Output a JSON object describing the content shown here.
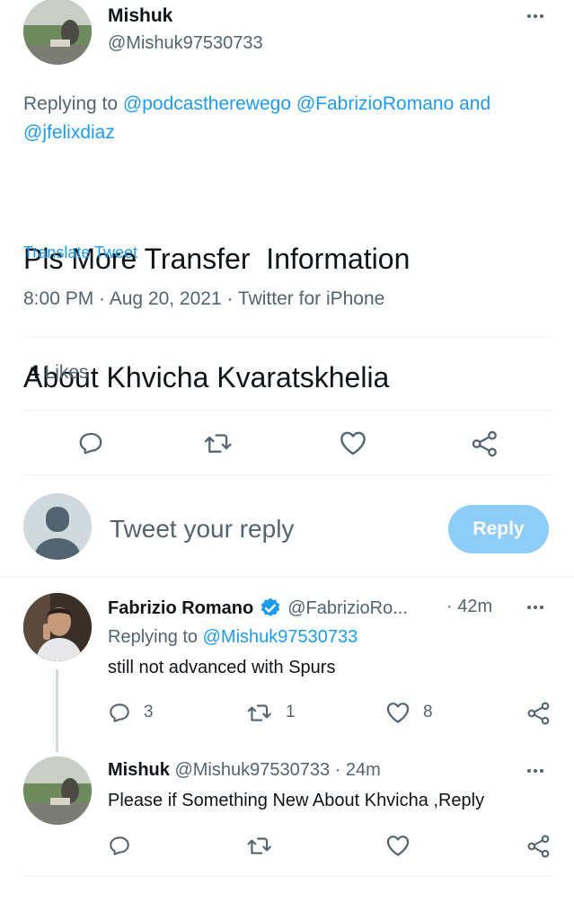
{
  "main_tweet": {
    "author_name": "Mishuk",
    "author_handle": "@Mishuk97530733",
    "replying_prefix": "Replying to",
    "replying_to": [
      "@podcastherewego",
      "@FabrizioRomano"
    ],
    "replying_and": "and",
    "replying_to_last": "@jfelixdiaz",
    "text_line1": "Pls More Transfer  Information",
    "text_line2": "About Khvicha Kvaratskhelia",
    "translate": "Translate Tweet",
    "timestamp": "8:00 PM · Aug 20, 2021 · Twitter for iPhone",
    "likes_count": "4",
    "likes_label": "Likes"
  },
  "composer": {
    "placeholder": "Tweet your reply",
    "reply_button": "Reply"
  },
  "replies": [
    {
      "author_name": "Fabrizio Romano",
      "verified": true,
      "author_handle": "@FabrizioRo...",
      "time": "· 42m",
      "replying_prefix": "Replying to",
      "replying_to": "@Mishuk97530733",
      "text": "still not advanced with Spurs",
      "reply_count": "3",
      "retweet_count": "1",
      "like_count": "8"
    },
    {
      "author_name": "Mishuk",
      "author_handle": "@Mishuk97530733",
      "time": "· 24m",
      "text": "Please if Something New About Khvicha ,Reply"
    }
  ],
  "icons": [
    "more-icon",
    "reply-icon",
    "retweet-icon",
    "like-icon",
    "share-icon",
    "verified-icon",
    "default-avatar-icon"
  ],
  "colors": {
    "accent": "#1d9bf0",
    "reply_button_disabled": "#8ecdf8",
    "muted": "#536471"
  }
}
